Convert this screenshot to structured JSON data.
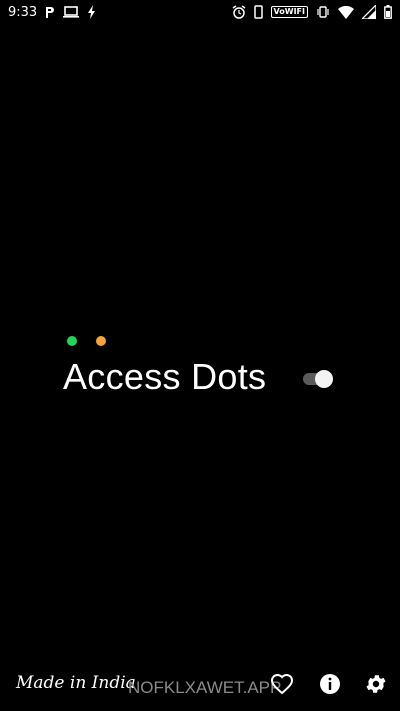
{
  "status_bar": {
    "time": "9:33",
    "left_icons": [
      "parking-icon",
      "laptop-icon",
      "flash-icon"
    ],
    "right_icons": [
      "alarm-icon",
      "phone-icon",
      "volte-wifi-icon",
      "vibrate-icon",
      "wifi-icon",
      "signal-icon",
      "battery-icon"
    ],
    "volte_label": "VoWIFI"
  },
  "main": {
    "dots": [
      {
        "name": "green-dot",
        "color": "#22d655"
      },
      {
        "name": "orange-dot",
        "color": "#f5a33b"
      }
    ],
    "title": "Access Dots",
    "toggle_state": "on"
  },
  "footer": {
    "made_in_india": "Made in India",
    "watermark": "NOFKLXAWET.APP",
    "icons": [
      "heart-icon",
      "info-icon",
      "settings-icon"
    ]
  }
}
